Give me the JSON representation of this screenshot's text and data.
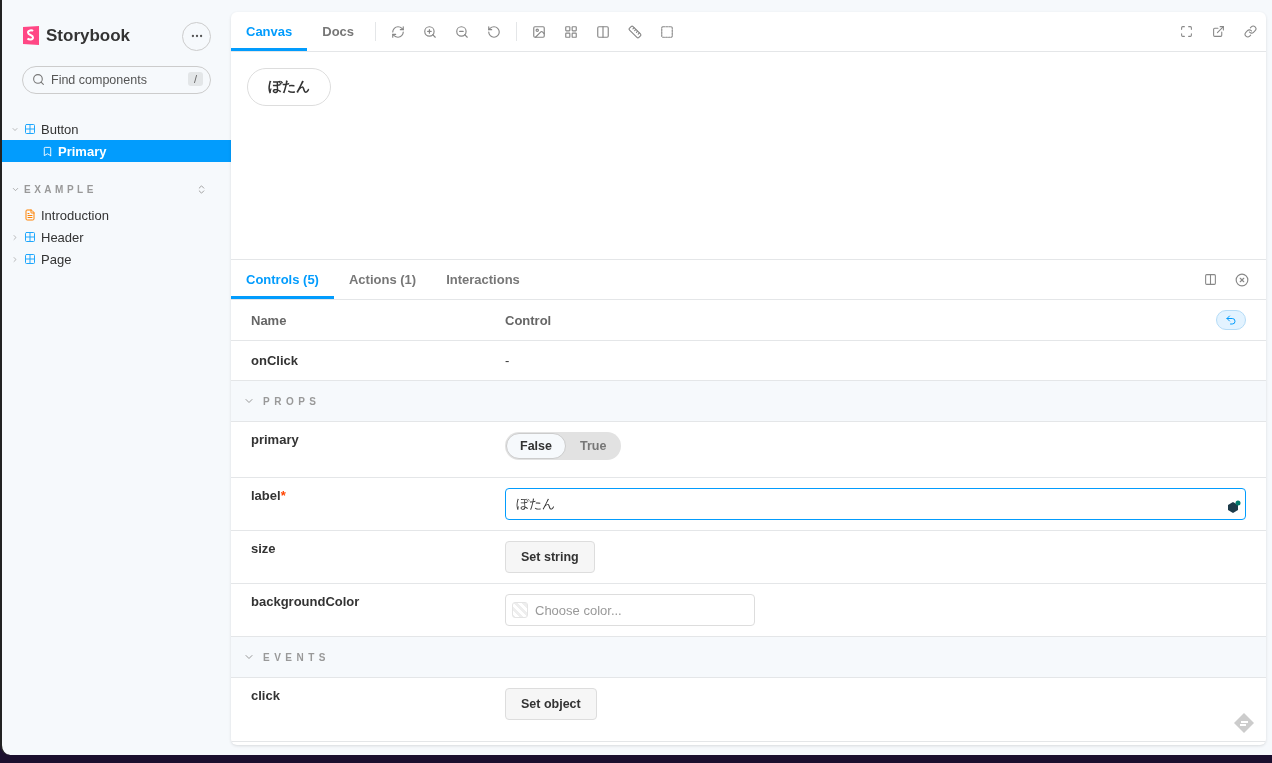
{
  "sidebar": {
    "brand": "Storybook",
    "search": {
      "placeholder": "Find components",
      "shortcut": "/"
    },
    "tree": [
      {
        "label": "Button",
        "kind": "component",
        "expanded": true,
        "selected": false,
        "children": [
          {
            "label": "Primary",
            "kind": "story",
            "selected": true
          }
        ]
      }
    ],
    "groups": [
      {
        "label": "EXAMPLE",
        "expanded": true,
        "items": [
          {
            "label": "Introduction",
            "kind": "doc",
            "selected": false
          },
          {
            "label": "Header",
            "kind": "component",
            "expanded": false,
            "selected": false
          },
          {
            "label": "Page",
            "kind": "component",
            "expanded": false,
            "selected": false
          }
        ]
      }
    ]
  },
  "toolbar": {
    "tabs": [
      {
        "label": "Canvas",
        "selected": true
      },
      {
        "label": "Docs",
        "selected": false
      }
    ]
  },
  "preview": {
    "button_label": "ぼたん"
  },
  "addons": {
    "tabs": [
      {
        "label": "Controls (5)",
        "selected": true
      },
      {
        "label": "Actions (1)",
        "selected": false
      },
      {
        "label": "Interactions",
        "selected": false
      }
    ],
    "columns": [
      "Name",
      "Control"
    ],
    "rows": [
      {
        "kind": "row",
        "name": "onClick",
        "control": {
          "kind": "text",
          "text": "-"
        }
      },
      {
        "kind": "section",
        "label": "PROPS",
        "expanded": true
      },
      {
        "kind": "row",
        "name": "primary",
        "control": {
          "kind": "boolean",
          "options": [
            {
              "label": "False",
              "selected": true
            },
            {
              "label": "True",
              "selected": false
            }
          ]
        }
      },
      {
        "kind": "row",
        "name": "label",
        "required_mark": "*",
        "control": {
          "kind": "text-input",
          "value": "ぼたん",
          "focused": true
        }
      },
      {
        "kind": "row",
        "name": "size",
        "control": {
          "kind": "button",
          "label": "Set string"
        }
      },
      {
        "kind": "row",
        "name": "backgroundColor",
        "control": {
          "kind": "color",
          "placeholder": "Choose color..."
        }
      },
      {
        "kind": "section",
        "label": "EVENTS",
        "expanded": true
      },
      {
        "kind": "row",
        "name": "click",
        "control": {
          "kind": "button",
          "label": "Set object"
        }
      }
    ]
  }
}
